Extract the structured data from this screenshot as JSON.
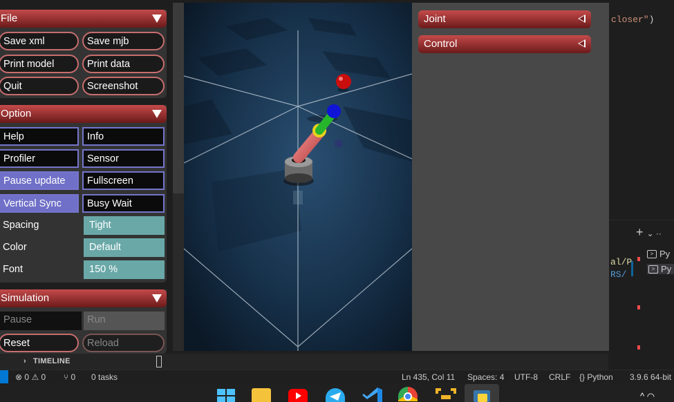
{
  "editor": {
    "code_closer_str": "closer\"",
    "code_closer_paren": ")",
    "path_frag_1": "al/P",
    "path_frag_2": "RS/"
  },
  "terminal": {
    "add_icon": "+",
    "more_icon": "⌄ ··",
    "items": [
      "Py",
      "Py"
    ]
  },
  "timeline": {
    "label": "TIMELINE"
  },
  "statusbar": {
    "errors": "0",
    "warnings": "0",
    "ports": "0",
    "tasks": "0 tasks",
    "position": "Ln 435, Col 11",
    "spaces": "Spaces: 4",
    "encoding": "UTF-8",
    "eol": "CRLF",
    "language": "Python",
    "interpreter": "3.9.6 64-bit"
  },
  "mujoco": {
    "file": {
      "title": "File",
      "buttons": [
        "Save xml",
        "Save mjb",
        "Print model",
        "Print data",
        "Quit",
        "Screenshot"
      ]
    },
    "option": {
      "title": "Option",
      "toggles": [
        {
          "label": "Help",
          "on": false
        },
        {
          "label": "Info",
          "on": false
        },
        {
          "label": "Profiler",
          "on": false
        },
        {
          "label": "Sensor",
          "on": false
        },
        {
          "label": "Pause update",
          "on": true
        },
        {
          "label": "Fullscreen",
          "on": false
        },
        {
          "label": "Vertical Sync",
          "on": true
        },
        {
          "label": "Busy Wait",
          "on": false
        }
      ],
      "spacing_label": "Spacing",
      "spacing_value": "Tight",
      "color_label": "Color",
      "color_value": "Default",
      "font_label": "Font",
      "font_value": "150 %"
    },
    "simulation": {
      "title": "Simulation",
      "pause": "Pause",
      "run": "Run",
      "reset": "Reset",
      "reload": "Reload"
    },
    "right": {
      "joint": "Joint",
      "control": "Control"
    }
  },
  "colors": {
    "section_header": "#a33434",
    "toggle_on": "#7070c8",
    "value_field": "#6aa8a8",
    "statusbar_accent": "#0078d4"
  },
  "taskbar_icons": [
    "windows-start-icon",
    "file-explorer-icon",
    "youtube-icon",
    "telegram-icon",
    "vscode-icon",
    "chrome-icon",
    "app-icon",
    "python-icon"
  ]
}
